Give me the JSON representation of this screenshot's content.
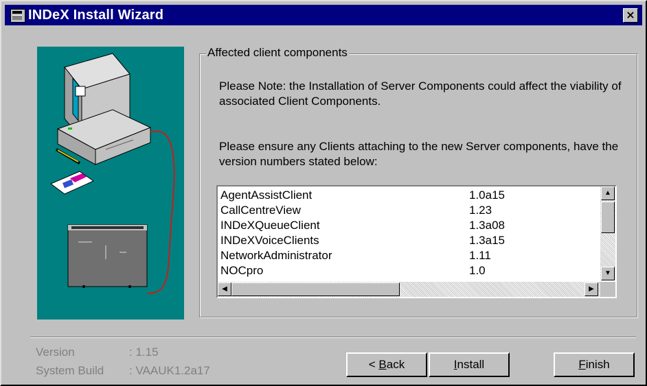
{
  "window": {
    "title": "INDeX Install Wizard",
    "close_glyph": "×"
  },
  "group": {
    "label": "Affected client components",
    "note1": "Please Note: the Installation of Server Components could affect the viability of associated Client Components.",
    "note2": "Please ensure any Clients attaching to the new Server components, have the version numbers stated below:"
  },
  "components": [
    {
      "name": "AgentAssistClient",
      "version": "1.0a15"
    },
    {
      "name": "CallCentreView",
      "version": "1.23"
    },
    {
      "name": "INDeXQueueClient",
      "version": "1.3a08"
    },
    {
      "name": "INDeXVoiceClients",
      "version": "1.3a15"
    },
    {
      "name": "NetworkAdministrator",
      "version": "1.11"
    },
    {
      "name": "NOCpro",
      "version": "1.0"
    }
  ],
  "info": {
    "version_label": "Version",
    "version_value": ": 1.15",
    "build_label": "System Build",
    "build_value": ": VAAUK1.2a17"
  },
  "buttons": {
    "back_pre": "< ",
    "back_mn": "B",
    "back_post": "ack",
    "install_mn": "I",
    "install_post": "nstall",
    "finish_mn": "F",
    "finish_post": "inish"
  },
  "icons": {
    "title": "app-window-icon",
    "close": "close-icon",
    "scroll_up": "arrow-up-icon",
    "scroll_down": "arrow-down-icon",
    "scroll_left": "arrow-left-icon",
    "scroll_right": "arrow-right-icon"
  },
  "colors": {
    "titlebar": "#000080",
    "side_panel": "#008080",
    "face": "#c0c0c0"
  }
}
